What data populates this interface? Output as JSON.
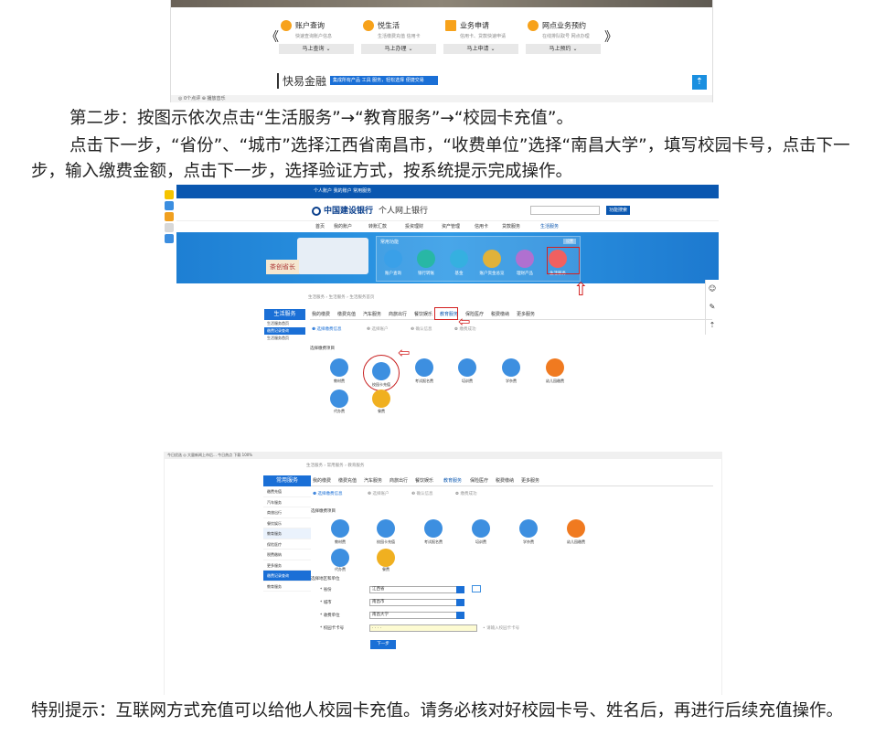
{
  "screenshot1": {
    "services": [
      {
        "title": "账户查询",
        "sub": "快速查询账户信息",
        "color": "#f7a21b"
      },
      {
        "title": "悦生活",
        "sub": "生活缴费充值 信用卡",
        "color": "#f7a21b"
      },
      {
        "title": "业务申请",
        "sub": "信用卡、贷款快速申请",
        "color": "#f7a21b"
      },
      {
        "title": "网点业务预约",
        "sub": "在线排队取号 网点办理",
        "color": "#f7a21b"
      }
    ],
    "buttons": [
      "马上查询 ⌄",
      "马上办理 ⌄",
      "马上申请 ⌄",
      "马上预约 ⌄"
    ],
    "arrow_left": "《",
    "arrow_right": "》",
    "kuai_label": "快易金融",
    "kuai_tag": "集成所有产品 工具 服务，轻松选择 便捷交易",
    "top_icon": "⇡",
    "status": "◎ 0个点评   ⊕ 播放音乐"
  },
  "para1": "第二步：按图示依次点击“生活服务”→“教育服务”→“校园卡充值”。",
  "para2": "点击下一步，“省份”、“城市”选择江西省南昌市，“收费单位”选择“南昌大学”，填写校园卡号，点击下一步，输入缴费金额，点击下一步，选择验证方式，按系统提示完成操作。",
  "screenshot2": {
    "topnav": "个人账户  我的账户  常用服务",
    "logo": "中国建设银行",
    "logo_en": "China Construction Bank",
    "logo_sub": "个人网上银行",
    "search_btn": "功能搜索",
    "menu": [
      "首页",
      "我的账户",
      "转账汇款",
      "投资理财",
      "资产管理",
      "信用卡",
      "贷款服务",
      "生活服务"
    ],
    "func_title": "常用功能",
    "func_set": "设置",
    "func_items": [
      {
        "label": "账户查询",
        "color": "#3aa0e8"
      },
      {
        "label": "银行转账",
        "color": "#28b7a5"
      },
      {
        "label": "基金",
        "color": "#35b0e0"
      },
      {
        "label": "账户资金总览",
        "color": "#e0b23a"
      },
      {
        "label": "理财产品",
        "color": "#b070d0"
      },
      {
        "label": "生活服务",
        "color": "#f06060"
      }
    ],
    "seal_text": "茶创省长",
    "crumb": "生活服务 › 生活服务 › 生活服务首页",
    "sidebar_title": "生活服务",
    "sidebar_items": [
      "生活服务首页",
      "缴费记录查询",
      "生活服务首页"
    ],
    "tabs": [
      "我的缴费",
      "缴费充值",
      "汽车服务",
      "商旅出行",
      "餐饮娱乐",
      "教育服务",
      "保险医疗",
      "税费缴纳",
      "更多服务"
    ],
    "steps": [
      "❶ 选择缴费信息",
      "❷ 选择账户",
      "❸ 确认信息",
      "❹ 缴费成功"
    ],
    "section": "选择缴费项目",
    "fees": [
      {
        "label": "教材费",
        "color": "#3d8fe0"
      },
      {
        "label": "校园卡充值",
        "color": "#3d8fe0"
      },
      {
        "label": "考试报名费",
        "color": "#3d8fe0"
      },
      {
        "label": "培训费",
        "color": "#3d8fe0"
      },
      {
        "label": "学杂费",
        "color": "#3d8fe0"
      },
      {
        "label": "幼儿园缴费",
        "color": "#f07a20"
      },
      {
        "label": "代办费",
        "color": "#3d8fe0"
      },
      {
        "label": "餐费",
        "color": "#f0b020"
      }
    ],
    "status": "今日优选   ◎ 大量新闻上市后... 今日热点 下载 100%",
    "dock": [
      "☺",
      "✎",
      "⇡"
    ]
  },
  "screenshot3": {
    "crumb": "生活服务 › 常用服务 › 教育服务",
    "sidebar_title": "常用服务",
    "sidebar_items": [
      "缴费充值",
      "汽车服务",
      "商旅出行",
      "餐饮娱乐",
      "教育服务",
      "保险医疗",
      "税费缴纳",
      "更多服务",
      "缴费记录查询",
      "教育服务"
    ],
    "tabs": [
      "我的缴费",
      "缴费充值",
      "汽车服务",
      "商旅出行",
      "餐饮娱乐",
      "教育服务",
      "保险医疗",
      "税费缴纳",
      "更多服务"
    ],
    "steps": [
      "❶ 选择缴费信息",
      "❷ 选择账户",
      "❸ 确认信息",
      "❹ 缴费成功"
    ],
    "section": "选择缴费项目",
    "region_section": "选择地区和单位",
    "form": [
      {
        "label": "省份",
        "value": "江西省"
      },
      {
        "label": "城市",
        "value": "南昌市"
      },
      {
        "label": "收费单位",
        "value": "南昌大学"
      },
      {
        "label": "校园卡卡号",
        "value": ". . . ."
      }
    ],
    "hint": "请输入校园卡卡号",
    "next": "下一步"
  },
  "para3": "特别提示：互联网方式充值可以给他人校园卡充值。请务必核对好校园卡号、姓名后，再进行后续充值操作。"
}
